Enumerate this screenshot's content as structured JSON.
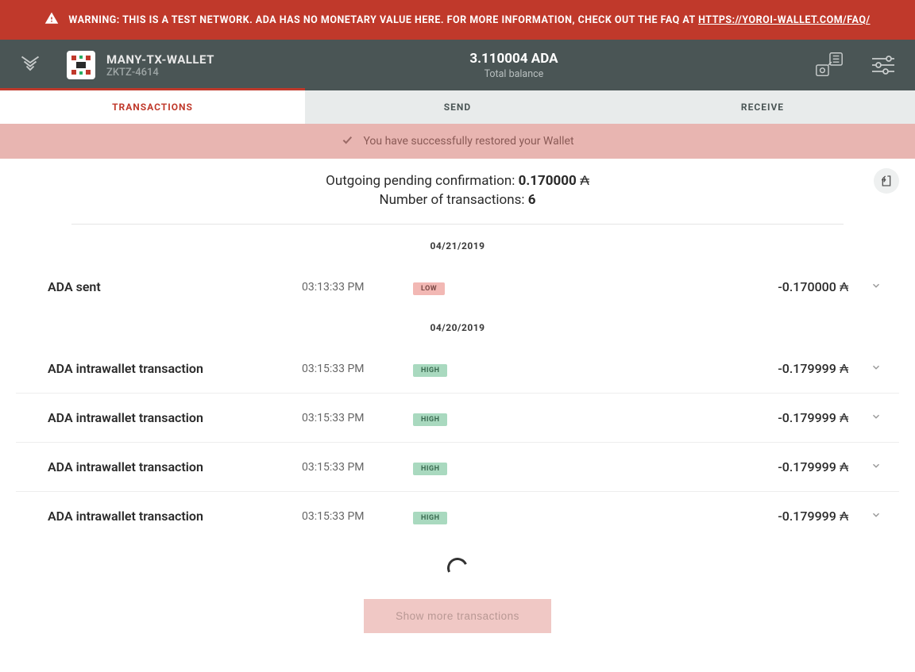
{
  "warning": {
    "prefix": "WARNING: THIS IS A TEST NETWORK. ADA HAS NO MONETARY VALUE HERE. FOR MORE INFORMATION, CHECK OUT THE FAQ AT ",
    "link_text": "HTTPS://YOROI-WALLET.COM/FAQ/"
  },
  "header": {
    "wallet_name": "MANY-TX-WALLET",
    "wallet_code": "ZKTZ-4614",
    "balance": "3.110004 ADA",
    "balance_label": "Total balance"
  },
  "tabs": {
    "transactions": "TRANSACTIONS",
    "send": "SEND",
    "receive": "RECEIVE"
  },
  "success_message": "You have successfully restored your Wallet",
  "summary": {
    "pending_label": "Outgoing pending confirmation: ",
    "pending_value": "0.170000",
    "pending_symbol": " ₳",
    "count_label": "Number of transactions: ",
    "count_value": "6"
  },
  "groups": [
    {
      "date": "04/21/2019",
      "transactions": [
        {
          "type": "ADA sent",
          "time": "03:13:33 PM",
          "badge": "LOW",
          "badge_class": "low",
          "amount": "-0.170000",
          "symbol": " ₳"
        }
      ]
    },
    {
      "date": "04/20/2019",
      "transactions": [
        {
          "type": "ADA intrawallet transaction",
          "time": "03:15:33 PM",
          "badge": "HIGH",
          "badge_class": "high",
          "amount": "-0.179999",
          "symbol": " ₳"
        },
        {
          "type": "ADA intrawallet transaction",
          "time": "03:15:33 PM",
          "badge": "HIGH",
          "badge_class": "high",
          "amount": "-0.179999",
          "symbol": " ₳"
        },
        {
          "type": "ADA intrawallet transaction",
          "time": "03:15:33 PM",
          "badge": "HIGH",
          "badge_class": "high",
          "amount": "-0.179999",
          "symbol": " ₳"
        },
        {
          "type": "ADA intrawallet transaction",
          "time": "03:15:33 PM",
          "badge": "HIGH",
          "badge_class": "high",
          "amount": "-0.179999",
          "symbol": " ₳"
        }
      ]
    }
  ],
  "show_more_label": "Show more transactions"
}
